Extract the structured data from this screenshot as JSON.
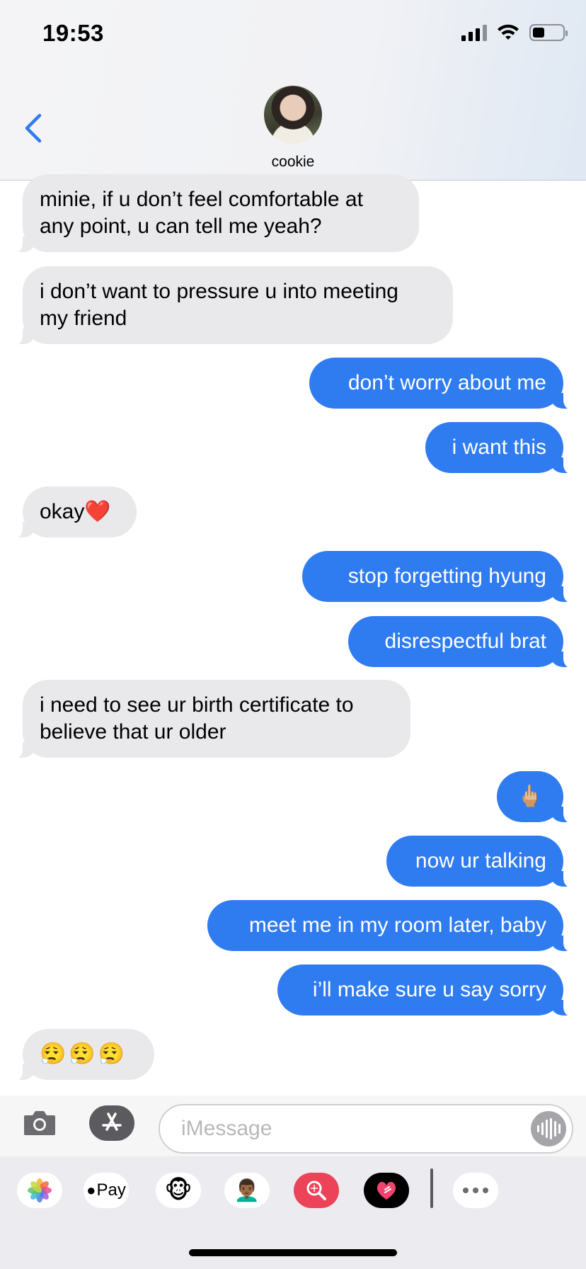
{
  "status_bar": {
    "time": "19:53"
  },
  "header": {
    "contact_name": "cookie"
  },
  "messages": [
    {
      "from": "them",
      "text": "minie, if u don’t feel comfortable at\nany point, u can tell me yeah?"
    },
    {
      "from": "them",
      "text": "i don’t want to pressure u into meeting\nmy friend"
    },
    {
      "from": "me",
      "text": "don’t worry about me"
    },
    {
      "from": "me",
      "text": "i want this"
    },
    {
      "from": "them",
      "text": "okay❤️"
    },
    {
      "from": "me",
      "text": "stop forgetting hyung"
    },
    {
      "from": "me",
      "text": "disrespectful brat"
    },
    {
      "from": "them",
      "text": "i need to see ur birth certificate to\nbelieve that ur older"
    },
    {
      "from": "me",
      "text": "🖕🏼"
    },
    {
      "from": "me",
      "text": "now ur talking"
    },
    {
      "from": "me",
      "text": "meet me in my room later, baby"
    },
    {
      "from": "me",
      "text": "i’ll make sure u say sorry"
    },
    {
      "from": "them",
      "text": "😮‍💨😮‍💨😮‍💨"
    }
  ],
  "compose": {
    "placeholder": "iMessage"
  },
  "app_drawer": {
    "apple_pay_label": "Pay",
    "apps": [
      "photos-app",
      "apple-pay-app",
      "animoji-app",
      "memoji-app",
      "images-search-app",
      "digital-touch-app",
      "more-apps"
    ]
  }
}
